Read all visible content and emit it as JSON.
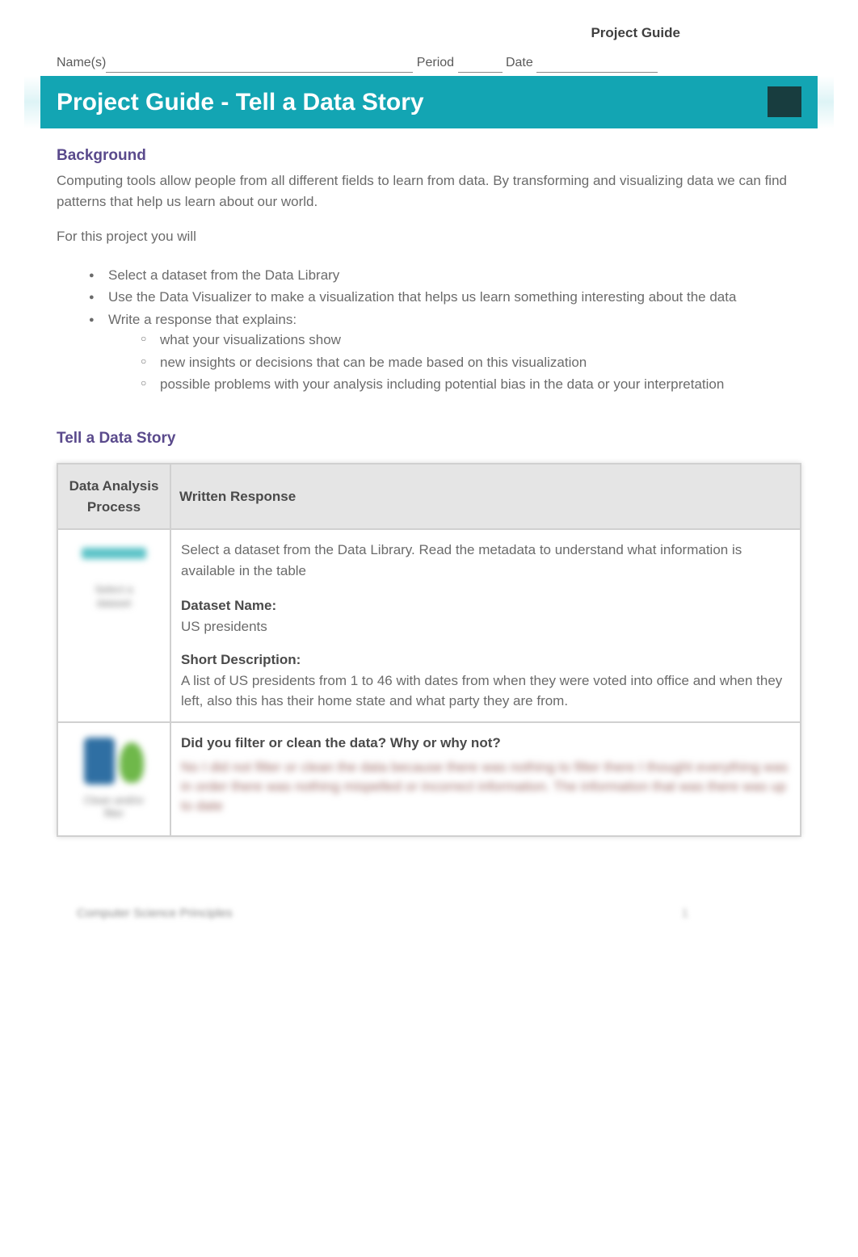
{
  "header": {
    "doc_label": "Project Guide",
    "names_label": "Name(s)",
    "period_label": "Period",
    "date_label": "Date"
  },
  "banner": {
    "title": "Project Guide - Tell a Data Story"
  },
  "background": {
    "heading": "Background",
    "p1": "Computing tools allow people from all different fields to learn from data. By transforming and visualizing data we can find patterns that help us learn about our world.",
    "p2": "For this project you will",
    "bullets": [
      "Select a dataset from the Data Library",
      "Use the Data Visualizer to make a visualization that helps us learn something interesting about the data",
      "Write a response that explains:"
    ],
    "sub_bullets": [
      "what your visualizations show",
      "new insights or decisions that can be made based on this visualization",
      "possible problems with your analysis including potential bias in the data or your interpretation"
    ]
  },
  "section2_heading": "Tell a Data Story",
  "table": {
    "col1": "Data Analysis Process",
    "col2": "Written Response",
    "row1": {
      "img_caption": "Select a dataset",
      "intro": "Select a dataset from the Data Library. Read the metadata to understand what information is available in the table",
      "dataset_label": "Dataset Name:",
      "dataset_value": "US presidents",
      "desc_label": "Short Description:",
      "desc_value": "A list of US presidents from 1 to 46 with dates from when they were voted into office and when they left, also this has their home state and what party they are from."
    },
    "row2": {
      "img_caption": "Clean and/or filter",
      "question": "Did you filter or clean the data? Why or why not?",
      "blurred_answer": "No I did not filter or clean the data because there was nothing to filter there I thought everything was in order there was nothing mispelled or incorrect information. The information that was there was up to date"
    }
  },
  "footer": {
    "left": "Computer Science Principles",
    "right": "1"
  }
}
